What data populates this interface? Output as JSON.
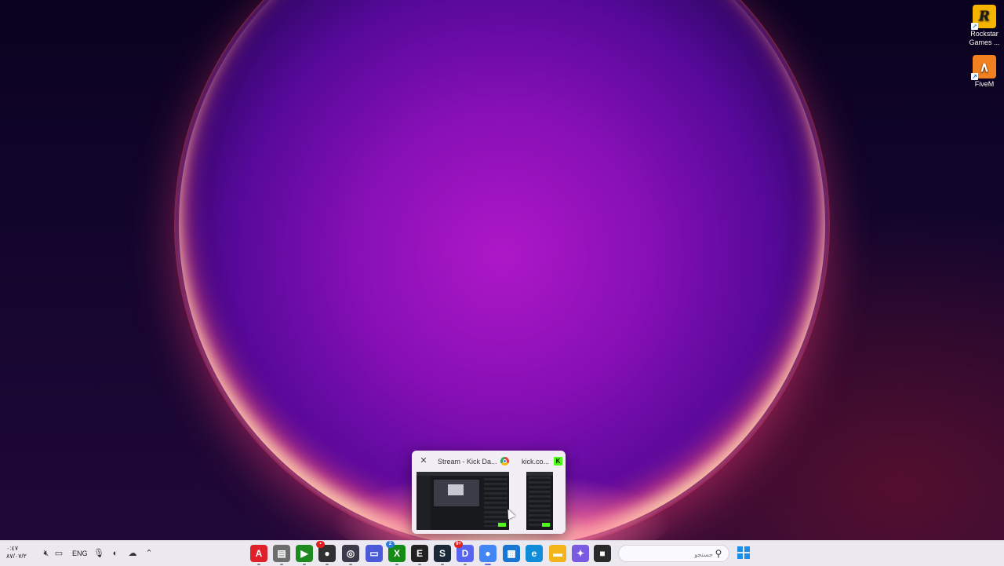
{
  "desktop": {
    "icons": [
      {
        "name": "Rockstar Games ...",
        "line1": "Rockstar",
        "line2": "Games ...",
        "glyph": "R",
        "icon": "rockstar-icon"
      },
      {
        "name": "FiveM",
        "line1": "FiveM",
        "glyph": "∧",
        "icon": "fivem-icon"
      }
    ]
  },
  "preview": {
    "windows": [
      {
        "title": "Stream - Kick Da...",
        "favicon": "chrome-icon",
        "close_label": "✕"
      },
      {
        "title": "kick.co...",
        "favicon": "kick-icon",
        "favicon_glyph": "K"
      }
    ]
  },
  "taskbar": {
    "clock_time": "٠:٤٧",
    "clock_date": "٨٧/٠٧/٢",
    "language": "ENG",
    "tray_icons": [
      "chevron-up-icon",
      "onedrive-icon",
      "network-icon",
      "microphone-icon",
      "volume-muted-icon",
      "display-icon"
    ],
    "apps": [
      {
        "name": "adobe-app",
        "glyph": "A",
        "color": "#e0202a"
      },
      {
        "name": "notepad-app",
        "glyph": "▤",
        "color": "#6d6d6d"
      },
      {
        "name": "nvidia-app",
        "glyph": "▶",
        "color": "#1f8a1f"
      },
      {
        "name": "obs-app",
        "glyph": "●",
        "color": "#303030"
      },
      {
        "name": "webcam-app",
        "glyph": "◎",
        "color": "#3a3a4a"
      },
      {
        "name": "chat-app",
        "glyph": "▭",
        "color": "#4a5ad8"
      },
      {
        "name": "xbox-app",
        "glyph": "X",
        "color": "#168a16"
      },
      {
        "name": "epic-games-app",
        "glyph": "E",
        "color": "#222"
      },
      {
        "name": "steam-app",
        "glyph": "S",
        "color": "#1b2838"
      },
      {
        "name": "discord-app",
        "glyph": "D",
        "color": "#5865f2"
      },
      {
        "name": "chrome-app",
        "glyph": "●",
        "color": "#4285f4"
      },
      {
        "name": "store-app",
        "glyph": "▦",
        "color": "#1976d2"
      },
      {
        "name": "edge-app",
        "glyph": "e",
        "color": "#0f8dd8"
      },
      {
        "name": "file-explorer-app",
        "glyph": "▬",
        "color": "#f2b418"
      },
      {
        "name": "copilot-app",
        "glyph": "✦",
        "color": "#7a5ae0"
      },
      {
        "name": "terminal-app",
        "glyph": "■",
        "color": "#2a2a2a"
      }
    ],
    "search_placeholder": "جستجو",
    "badges": {
      "obs": "•",
      "xbox": "2",
      "discord": "9+"
    }
  }
}
